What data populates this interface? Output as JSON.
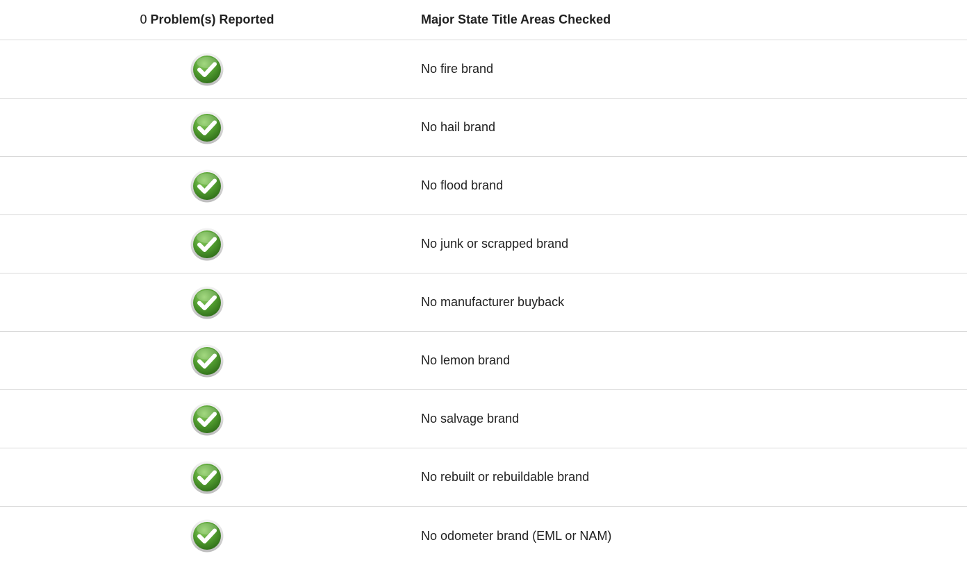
{
  "header": {
    "count": "0",
    "problems_label": "Problem(s) Reported",
    "areas_label": "Major State Title Areas Checked"
  },
  "colors": {
    "check_green": "#4f9a2e",
    "divider": "#d9d9d9"
  },
  "rows": [
    {
      "status_icon": "green-check-icon",
      "label": "No fire brand"
    },
    {
      "status_icon": "green-check-icon",
      "label": "No hail brand"
    },
    {
      "status_icon": "green-check-icon",
      "label": "No flood brand"
    },
    {
      "status_icon": "green-check-icon",
      "label": "No junk or scrapped brand"
    },
    {
      "status_icon": "green-check-icon",
      "label": "No manufacturer buyback"
    },
    {
      "status_icon": "green-check-icon",
      "label": "No lemon brand"
    },
    {
      "status_icon": "green-check-icon",
      "label": "No salvage brand"
    },
    {
      "status_icon": "green-check-icon",
      "label": "No rebuilt or rebuildable brand"
    },
    {
      "status_icon": "green-check-icon",
      "label": "No odometer brand (EML or NAM)"
    }
  ]
}
